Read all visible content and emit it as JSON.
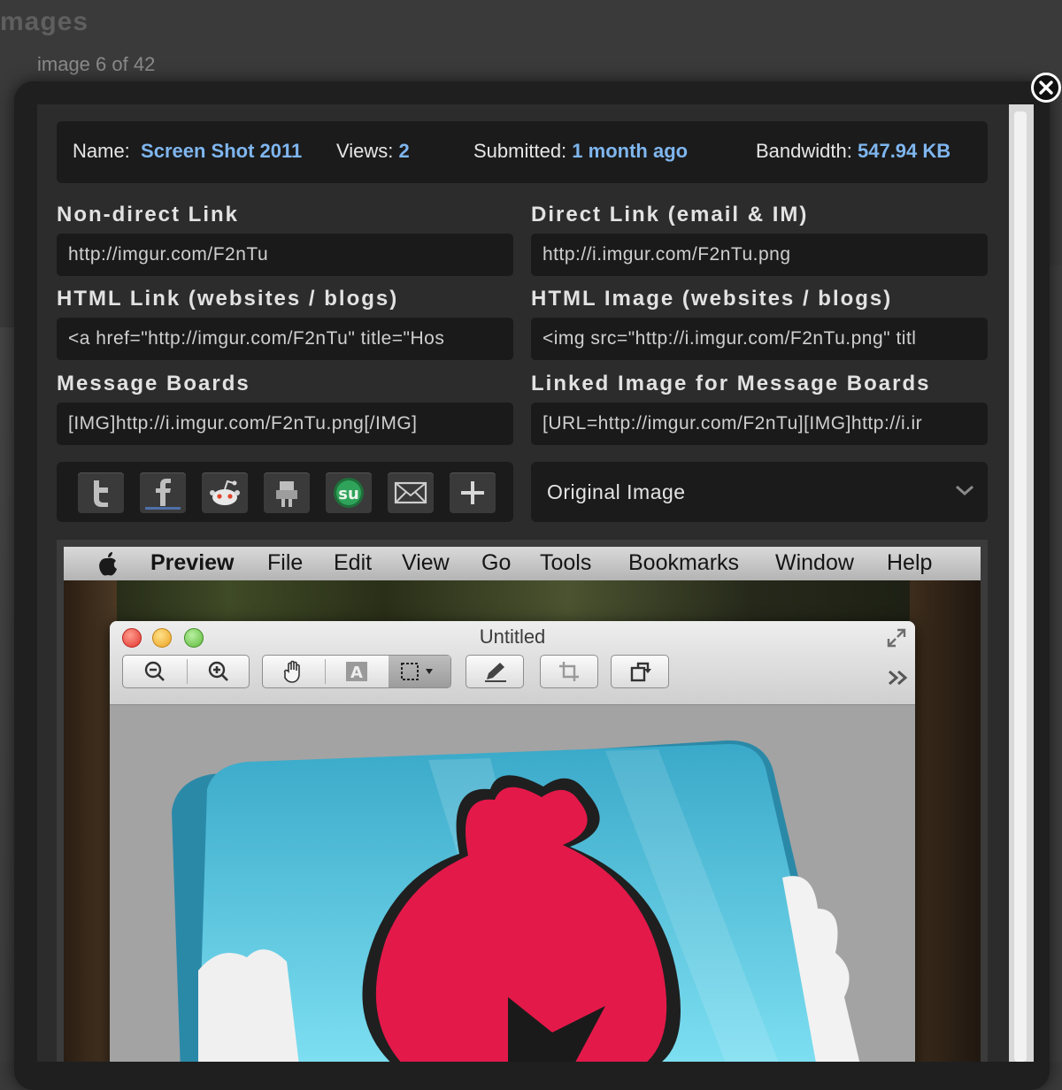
{
  "background": {
    "title": "mages",
    "counter": "image 6 of 42"
  },
  "info": {
    "name_label": "Name:",
    "name_value": "Screen Shot 2011",
    "views_label": "Views:",
    "views_value": "2",
    "submitted_label": "Submitted:",
    "submitted_value": "1 month ago",
    "bandwidth_label": "Bandwidth:",
    "bandwidth_value": "547.94 KB"
  },
  "links": {
    "nondirect_label": "Non-direct Link",
    "nondirect_value": "http://imgur.com/F2nTu",
    "direct_label": "Direct Link (email & IM)",
    "direct_value": "http://i.imgur.com/F2nTu.png",
    "html_link_label": "HTML Link (websites / blogs)",
    "html_link_value": "<a href=\"http://imgur.com/F2nTu\" title=\"Hos",
    "html_image_label": "HTML Image (websites / blogs)",
    "html_image_value": "<img src=\"http://i.imgur.com/F2nTu.png\" titl",
    "boards_label": "Message Boards",
    "boards_value": "[IMG]http://i.imgur.com/F2nTu.png[/IMG]",
    "linked_boards_label": "Linked Image for Message Boards",
    "linked_boards_value": "[URL=http://imgur.com/F2nTu][IMG]http://i.ir"
  },
  "share": {
    "icons": [
      "twitter-icon",
      "facebook-icon",
      "reddit-icon",
      "digg-icon",
      "stumbleupon-icon",
      "email-icon",
      "plus-icon"
    ]
  },
  "size_select": {
    "selected": "Original Image"
  },
  "screenshot": {
    "menubar": [
      "Preview",
      "File",
      "Edit",
      "View",
      "Go",
      "Tools",
      "Bookmarks",
      "Window",
      "Help"
    ],
    "window_title": "Untitled"
  },
  "colors": {
    "accent": "#7fb6ef",
    "panel": "#1b1b1b"
  }
}
